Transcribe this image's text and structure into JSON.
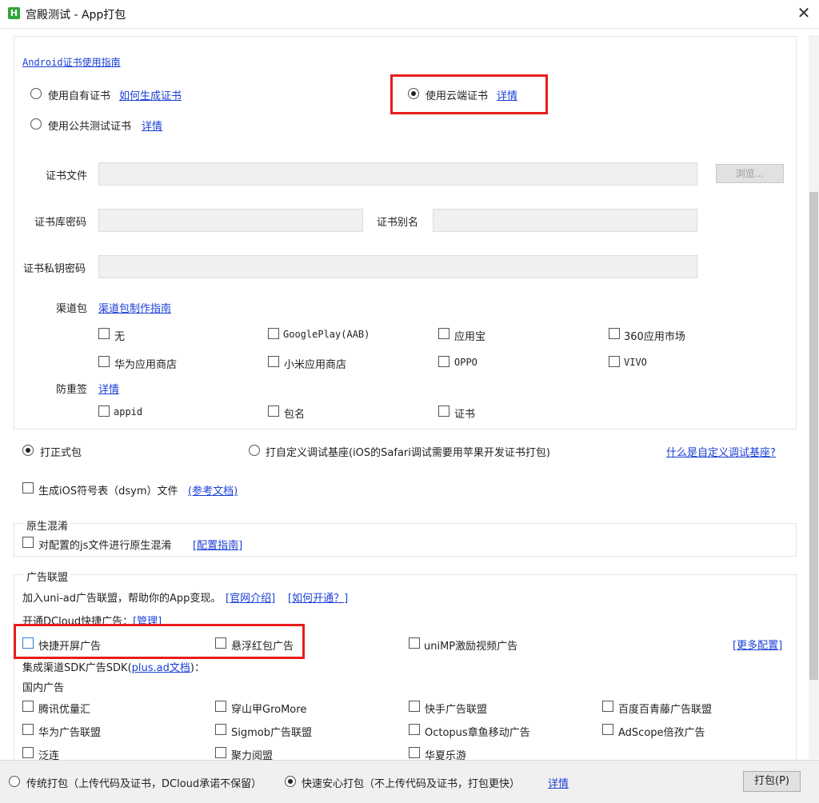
{
  "window": {
    "title": "宫殿测试 - App打包",
    "icon_letter": "H"
  },
  "android": {
    "guide_link": "Android证书使用指南",
    "cert_own": {
      "label": "使用自有证书",
      "link": "如何生成证书"
    },
    "cert_cloud": {
      "label": "使用云端证书",
      "link": "详情"
    },
    "cert_public": {
      "label": "使用公共测试证书",
      "link": "详情"
    },
    "cert_file_label": "证书文件",
    "browse": "浏览...",
    "keystore_pwd_label": "证书库密码",
    "alias_label": "证书别名",
    "key_pwd_label": "证书私钥密码",
    "channel": {
      "label": "渠道包",
      "link": "渠道包制作指南",
      "options": [
        "无",
        "GooglePlay(AAB)",
        "应用宝",
        "360应用市场",
        "华为应用商店",
        "小米应用商店",
        "OPPO",
        "VIVO"
      ]
    },
    "anti_resign": {
      "label": "防重签",
      "link": "详情",
      "options": [
        "appid",
        "包名",
        "证书"
      ]
    }
  },
  "build_type": {
    "formal": "打正式包",
    "custom_base": "打自定义调试基座(iOS的Safari调试需要用苹果开发证书打包)",
    "custom_base_link": "什么是自定义调试基座?"
  },
  "dsym": {
    "label": "生成iOS符号表（dsym）文件",
    "link": "(参考文档)"
  },
  "obfuscation": {
    "title": "原生混淆",
    "label": "对配置的js文件进行原生混淆",
    "link": "[配置指南]"
  },
  "ads": {
    "title": "广告联盟",
    "intro_text": "加入uni-ad广告联盟，帮助你的App变现。",
    "intro_link1": "[官网介绍]",
    "intro_link2": "[如何开通？]",
    "quick_label": "开通DCloud快捷广告：",
    "quick_link": "[管理]",
    "quick_options": [
      "快捷开屏广告",
      "悬浮红包广告",
      "uniMP激励视频广告"
    ],
    "more_config": "[更多配置]",
    "sdk_label": "集成渠道SDK广告SDK(",
    "sdk_link": "plus.ad文档",
    "sdk_tail": ")：",
    "domestic_label": "国内广告",
    "domestic_options": [
      "腾讯优量汇",
      "穿山甲GroMore",
      "快手广告联盟",
      "百度百青藤广告联盟",
      "华为广告联盟",
      "Sigmob广告联盟",
      "Octopus章鱼移动广告",
      "AdScope倍孜广告",
      "泛连",
      "聚力阅盟",
      "华夏乐游"
    ]
  },
  "footer": {
    "traditional": "传统打包（上传代码及证书，DCloud承诺不保留）",
    "safe": "快速安心打包（不上传代码及证书，打包更快）",
    "safe_link": "详情",
    "pack_button": "打包(P)"
  },
  "colors": {
    "link": "#1a3fd6",
    "highlight": "#e81c1c",
    "app_icon": "#2fa53a"
  }
}
